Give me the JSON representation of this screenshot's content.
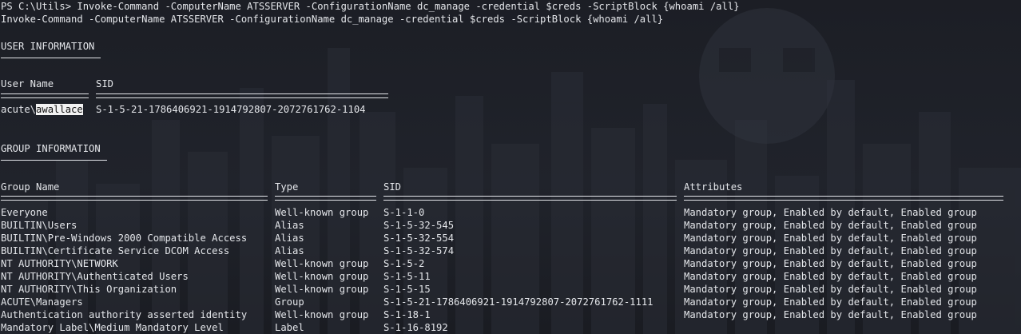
{
  "terminal": {
    "command_line": "PS C:\\Utils> Invoke-Command -ComputerName ATSSERVER -ConfigurationName dc_manage -credential $creds -ScriptBlock {whoami /all}",
    "echo_line": "Invoke-Command -ComputerName ATSSERVER -ConfigurationName dc_manage -credential $creds -ScriptBlock {whoami /all}"
  },
  "user_info": {
    "heading": "USER INFORMATION",
    "col_user": "User Name",
    "col_sid": "SID",
    "user_prefix": "acute\\",
    "user_selected": "awallace",
    "sid": "S-1-5-21-1786406921-1914792807-2072761762-1104"
  },
  "group_info": {
    "heading": "GROUP INFORMATION",
    "columns": [
      "Group Name",
      "Type",
      "SID",
      "Attributes"
    ],
    "rows": [
      {
        "name": "Everyone",
        "type": "Well-known group",
        "sid": "S-1-1-0",
        "attr": "Mandatory group, Enabled by default, Enabled group"
      },
      {
        "name": "BUILTIN\\Users",
        "type": "Alias",
        "sid": "S-1-5-32-545",
        "attr": "Mandatory group, Enabled by default, Enabled group"
      },
      {
        "name": "BUILTIN\\Pre-Windows 2000 Compatible Access",
        "type": "Alias",
        "sid": "S-1-5-32-554",
        "attr": "Mandatory group, Enabled by default, Enabled group"
      },
      {
        "name": "BUILTIN\\Certificate Service DCOM Access",
        "type": "Alias",
        "sid": "S-1-5-32-574",
        "attr": "Mandatory group, Enabled by default, Enabled group"
      },
      {
        "name": "NT AUTHORITY\\NETWORK",
        "type": "Well-known group",
        "sid": "S-1-5-2",
        "attr": "Mandatory group, Enabled by default, Enabled group"
      },
      {
        "name": "NT AUTHORITY\\Authenticated Users",
        "type": "Well-known group",
        "sid": "S-1-5-11",
        "attr": "Mandatory group, Enabled by default, Enabled group"
      },
      {
        "name": "NT AUTHORITY\\This Organization",
        "type": "Well-known group",
        "sid": "S-1-5-15",
        "attr": "Mandatory group, Enabled by default, Enabled group"
      },
      {
        "name": "ACUTE\\Managers",
        "type": "Group",
        "sid": "S-1-5-21-1786406921-1914792807-2072761762-1111",
        "attr": "Mandatory group, Enabled by default, Enabled group"
      },
      {
        "name": "Authentication authority asserted identity",
        "type": "Well-known group",
        "sid": "S-1-18-1",
        "attr": "Mandatory group, Enabled by default, Enabled group"
      },
      {
        "name": "Mandatory Label\\Medium Mandatory Level",
        "type": "Label",
        "sid": "S-1-16-8192",
        "attr": ""
      }
    ]
  },
  "colors": {
    "background": "#1d1f26",
    "text": "#e4e6ea",
    "selection_bg": "#f2f2f2",
    "selection_fg": "#111111"
  }
}
